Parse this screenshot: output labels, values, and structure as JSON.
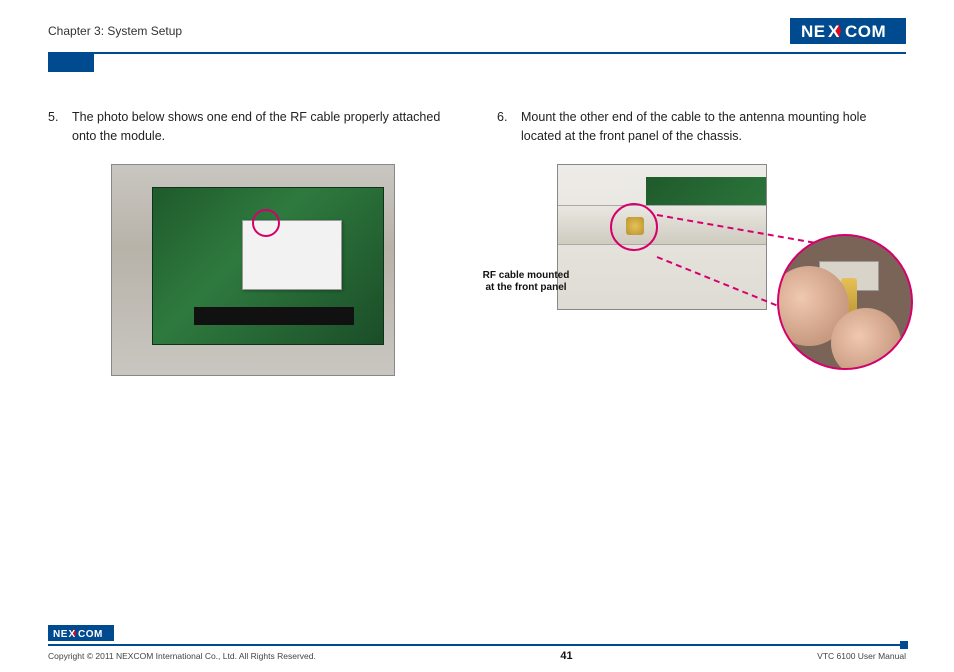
{
  "header": {
    "chapter": "Chapter 3: System Setup",
    "logo_text": "NEXCOM"
  },
  "steps": {
    "s5": {
      "num": "5.",
      "text": "The photo below shows one end of the RF cable properly attached onto the module."
    },
    "s6": {
      "num": "6.",
      "text": "Mount the other end of the cable to the antenna mounting hole located at the front panel of the chassis."
    }
  },
  "caption": {
    "fig2": "RF cable mounted at the front panel"
  },
  "footer": {
    "logo_text": "NEXCOM",
    "copyright": "Copyright © 2011 NEXCOM International Co., Ltd. All Rights Reserved.",
    "page": "41",
    "doc": "VTC 6100 User Manual"
  }
}
